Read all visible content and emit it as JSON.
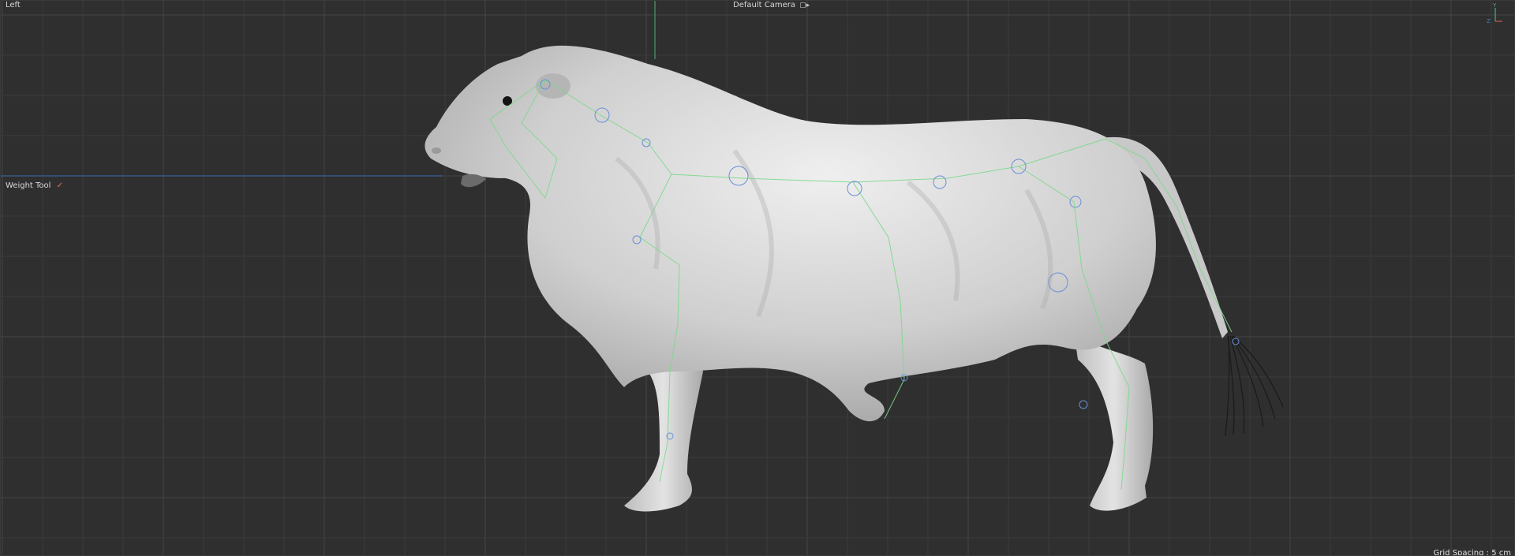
{
  "viewport": {
    "view_name": "Left",
    "camera_name": "Default Camera",
    "camera_icon": "camera-icon",
    "active_tool": "Weight Tool",
    "active_tool_icon": "brush-icon",
    "grid_spacing": "Grid Spacing : 5 cm",
    "axis_gizmo": {
      "y_label": "Y",
      "z_label": "Z"
    }
  },
  "colors": {
    "background": "#2f2f2f",
    "grid_line": "#3b3b3b",
    "grid_major": "#454545",
    "horizon_axis": "#3a6fb0",
    "vertical_axis": "#4caf7a",
    "mesh": "#d9d9d9",
    "rig": "#7cd98b",
    "joint": "#6a8ed8"
  }
}
